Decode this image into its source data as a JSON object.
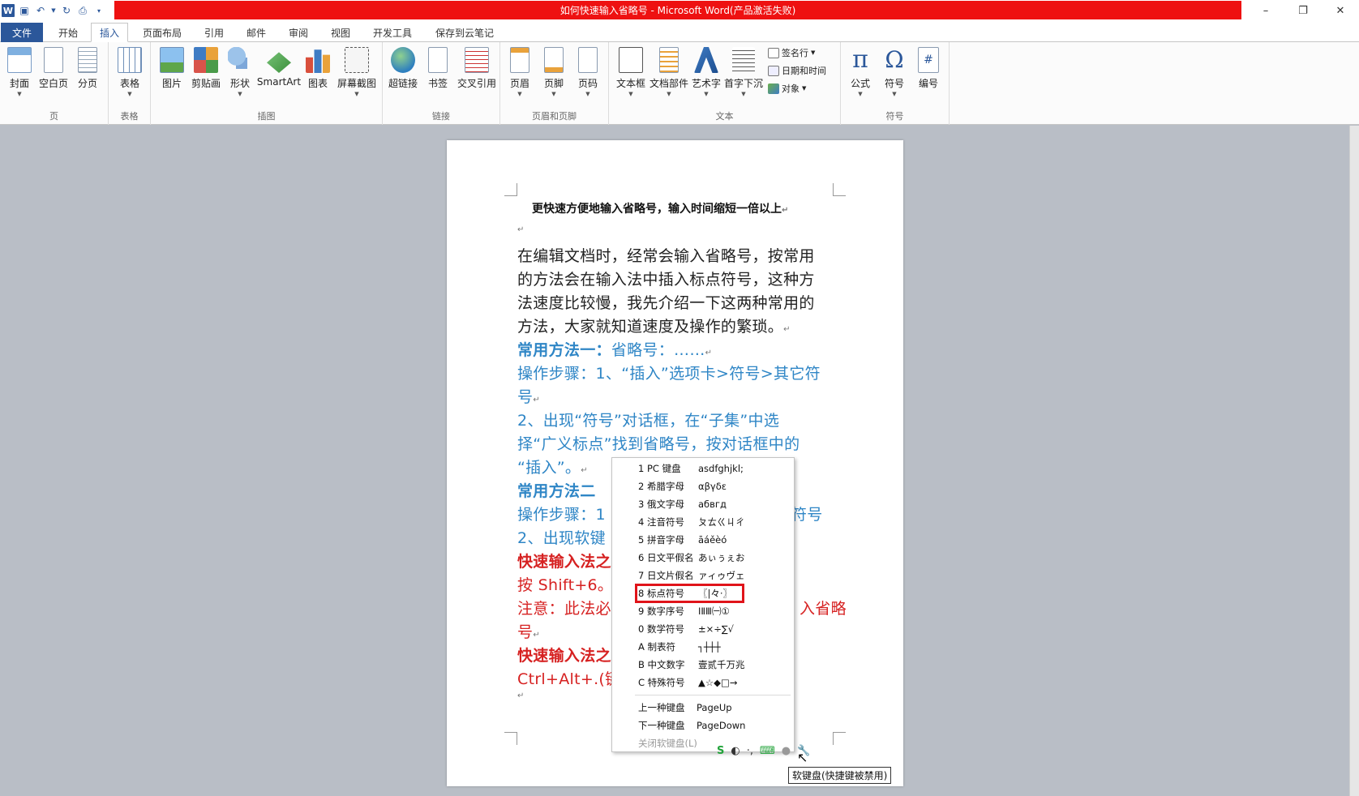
{
  "window": {
    "title": "如何快速输入省略号 - Microsoft Word(产品激活失败)",
    "controls": [
      "–",
      "❐",
      "✕"
    ]
  },
  "tabs": [
    "文件",
    "开始",
    "插入",
    "页面布局",
    "引用",
    "邮件",
    "审阅",
    "视图",
    "开发工具",
    "保存到云笔记"
  ],
  "ribbon": {
    "groups": {
      "page": {
        "label": "页",
        "buttons": [
          "封面",
          "空白页",
          "分页"
        ]
      },
      "table": {
        "label": "表格",
        "buttons": [
          "表格"
        ]
      },
      "illustrations": {
        "label": "插图",
        "buttons": [
          "图片",
          "剪贴画",
          "形状",
          "SmartArt",
          "图表",
          "屏幕截图"
        ]
      },
      "links": {
        "label": "链接",
        "buttons": [
          "超链接",
          "书签",
          "交叉引用"
        ]
      },
      "header_footer": {
        "label": "页眉和页脚",
        "buttons": [
          "页眉",
          "页脚",
          "页码"
        ]
      },
      "text": {
        "label": "文本",
        "buttons": [
          "文本框",
          "文档部件",
          "艺术字",
          "首字下沉"
        ],
        "small": [
          "签名行",
          "日期和时间",
          "对象"
        ]
      },
      "symbols": {
        "label": "符号",
        "buttons": [
          "公式",
          "符号",
          "编号"
        ]
      }
    }
  },
  "document": {
    "title": "更快速方便地输入省略号，输入时间缩短一倍以上",
    "lines": [
      "在编辑文档时，经常会输入省略号，按常用",
      "的方法会在输入法中插入标点符号，这种方",
      "法速度比较慢，我先介绍一下这两种常用的",
      "方法，大家就知道速度及操作的繁琐。",
      "常用方法一：",
      "省略号：……",
      "操作步骤：1、“插入”选项卡>符号>其它符",
      "号",
      "2、出现“符号”对话框，在“子集”中选",
      "择“广义标点”找到省略号，按对话框中的",
      "“插入”。",
      "常用方法二",
      "操作步骤：1",
      "符号",
      "2、出现软键",
      "快速输入法之",
      "按 Shift+6。",
      "注意：此法必",
      "入省略",
      "号",
      "快速输入法之",
      "Ctrl+Alt+.(键盘"
    ]
  },
  "soft_keyboard_menu": {
    "items": [
      {
        "name": "1 PC 键盘",
        "sample": "asdfghjkl;"
      },
      {
        "name": "2 希腊字母",
        "sample": "αβγδε"
      },
      {
        "name": "3 俄文字母",
        "sample": "абвгд"
      },
      {
        "name": "4 注音符号",
        "sample": "ㄆㄊㄍㄐㄔ"
      },
      {
        "name": "5 拼音字母",
        "sample": "āáěèó"
      },
      {
        "name": "6 日文平假名",
        "sample": "あぃぅぇお"
      },
      {
        "name": "7 日文片假名",
        "sample": "ァィゥヴェ"
      },
      {
        "name": "8 标点符号",
        "sample": "〖|々·〗"
      },
      {
        "name": "9 数字序号",
        "sample": "ⅠⅡⅢ㈠①"
      },
      {
        "name": "0 数学符号",
        "sample": "±×÷∑√"
      },
      {
        "name": "A 制表符",
        "sample": "┐┼┼┼"
      },
      {
        "name": "B 中文数字",
        "sample": "壹贰千万兆"
      },
      {
        "name": "C 特殊符号",
        "sample": "▲☆◆□→"
      }
    ],
    "nav": [
      {
        "name": "上一种键盘",
        "key": "PageUp"
      },
      {
        "name": "下一种键盘",
        "key": "PageDown"
      }
    ],
    "close_label": "关闭软键盘(L)",
    "highlighted_index": 7
  },
  "tooltip": "软键盘(快捷键被禁用)",
  "colors": {
    "title_red": "#ee1111",
    "accent": "#2b579a",
    "doc_blue": "#2f86c6",
    "doc_red": "#d62121",
    "highlight": "#e0141a"
  }
}
